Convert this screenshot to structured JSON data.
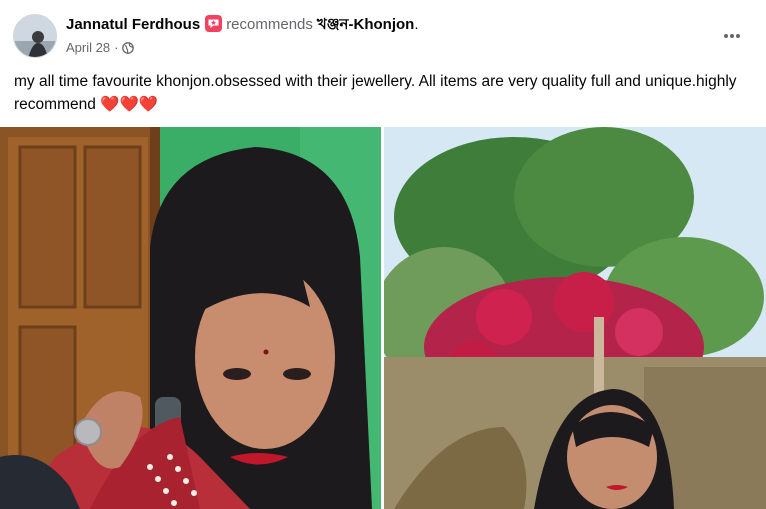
{
  "post": {
    "author": "Jannatul Ferdhous",
    "recommends_label": "recommends",
    "page_name": "খঞ্জন-Khonjon",
    "page_suffix": ".",
    "date": "April 28",
    "separator": "·",
    "privacy_icon": "globe-icon",
    "more_icon": "more-horizontal-icon",
    "text": "my all time favourite khonjon.obsessed with their jewellery. All items are very quality full and unique.highly recommend ❤️❤️❤️"
  },
  "colors": {
    "badge": "#f3425f",
    "secondary_text": "#65676b",
    "primary_text": "#050505"
  }
}
